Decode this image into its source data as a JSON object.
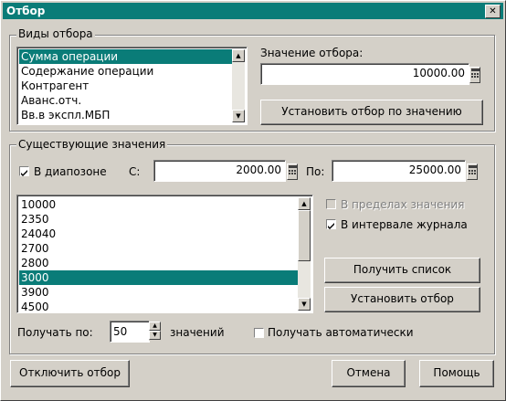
{
  "window": {
    "title": "Отбор",
    "close_glyph": "✕"
  },
  "kinds_group": {
    "label": "Виды отбора",
    "items": [
      "Сумма операции",
      "Содержание операции",
      "Контрагент",
      "Аванс.отч.",
      "Вв.в экспл.МБП"
    ],
    "selected_index": 0
  },
  "filter_value": {
    "label": "Значение отбора:",
    "value": "10000.00",
    "calc_icon": "calculator-icon"
  },
  "set_by_value_button": "Установить отбор по значению",
  "existing_group": {
    "label": "Существующие значения",
    "range_checkbox_label": "В диапозоне",
    "range_checked": true,
    "from_label": "С:",
    "from_value": "2000.00",
    "to_label": "По:",
    "to_value": "25000.00",
    "values": [
      "10000",
      "2350",
      "24040",
      "2700",
      "2800",
      "3000",
      "3900",
      "4500"
    ],
    "selected_index": 5,
    "within_value_label": "В пределах значения",
    "within_value_checked": false,
    "within_value_enabled": false,
    "journal_interval_label": "В интервале журнала",
    "journal_interval_checked": true,
    "get_list_button": "Получить список",
    "set_filter_button": "Установить отбор",
    "fetch_by_label": "Получать по:",
    "fetch_by_value": "50",
    "values_suffix": "значений",
    "auto_fetch_label": "Получать автоматически",
    "auto_fetch_checked": false
  },
  "bottom": {
    "disable_filter_button": "Отключить отбор",
    "cancel_button": "Отмена",
    "help_button": "Помощь"
  },
  "colors": {
    "selection": "#0a7c78",
    "face": "#d4d0c8"
  }
}
